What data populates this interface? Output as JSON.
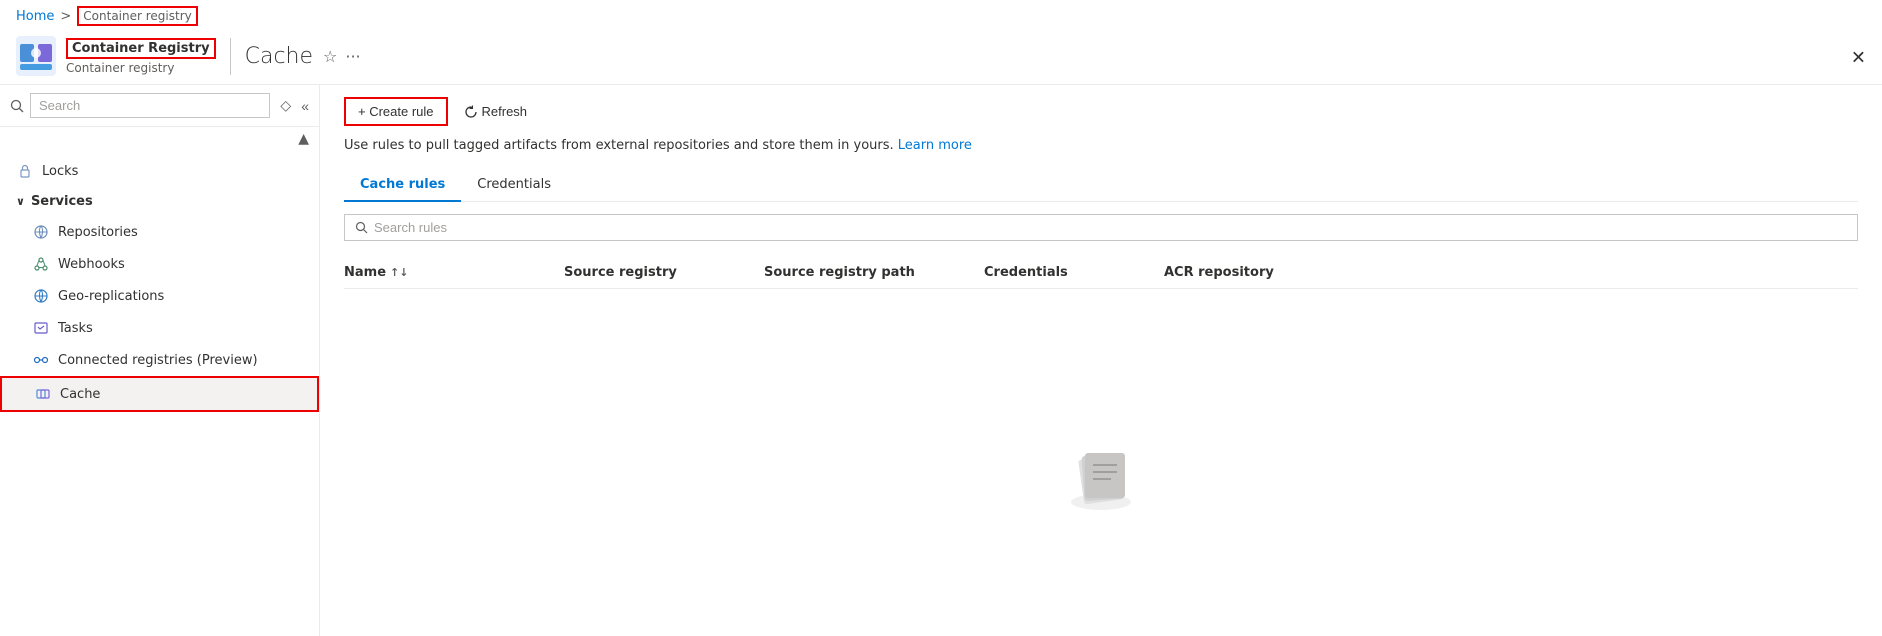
{
  "breadcrumb": {
    "home": "Home",
    "separator": ">",
    "current": "Container registry"
  },
  "header": {
    "resource_name": "Container Registry",
    "resource_type": "Container registry",
    "page_title": "Cache",
    "star_icon": "☆",
    "more_icon": "···",
    "close_icon": "✕"
  },
  "sidebar": {
    "search_placeholder": "Search",
    "items": [
      {
        "label": "Locks",
        "icon": "lock"
      },
      {
        "label": "Services",
        "is_section": true,
        "expanded": true
      },
      {
        "label": "Repositories",
        "icon": "repo"
      },
      {
        "label": "Webhooks",
        "icon": "webhook"
      },
      {
        "label": "Geo-replications",
        "icon": "geo"
      },
      {
        "label": "Tasks",
        "icon": "tasks"
      },
      {
        "label": "Connected registries (Preview)",
        "icon": "connected"
      },
      {
        "label": "Cache",
        "icon": "cache",
        "active": true
      }
    ]
  },
  "toolbar": {
    "create_label": "+ Create rule",
    "refresh_label": "Refresh"
  },
  "info_text": "Use rules to pull tagged artifacts from external repositories and store them in yours.",
  "learn_more": "Learn more",
  "tabs": [
    {
      "label": "Cache rules",
      "active": true
    },
    {
      "label": "Credentials",
      "active": false
    }
  ],
  "search_rules_placeholder": "Search rules",
  "table_columns": [
    {
      "label": "Name",
      "sortable": true
    },
    {
      "label": "Source registry"
    },
    {
      "label": "Source registry path"
    },
    {
      "label": "Credentials"
    },
    {
      "label": "ACR repository"
    }
  ],
  "colors": {
    "accent": "#0078d4",
    "border_highlight": "#e00000"
  }
}
